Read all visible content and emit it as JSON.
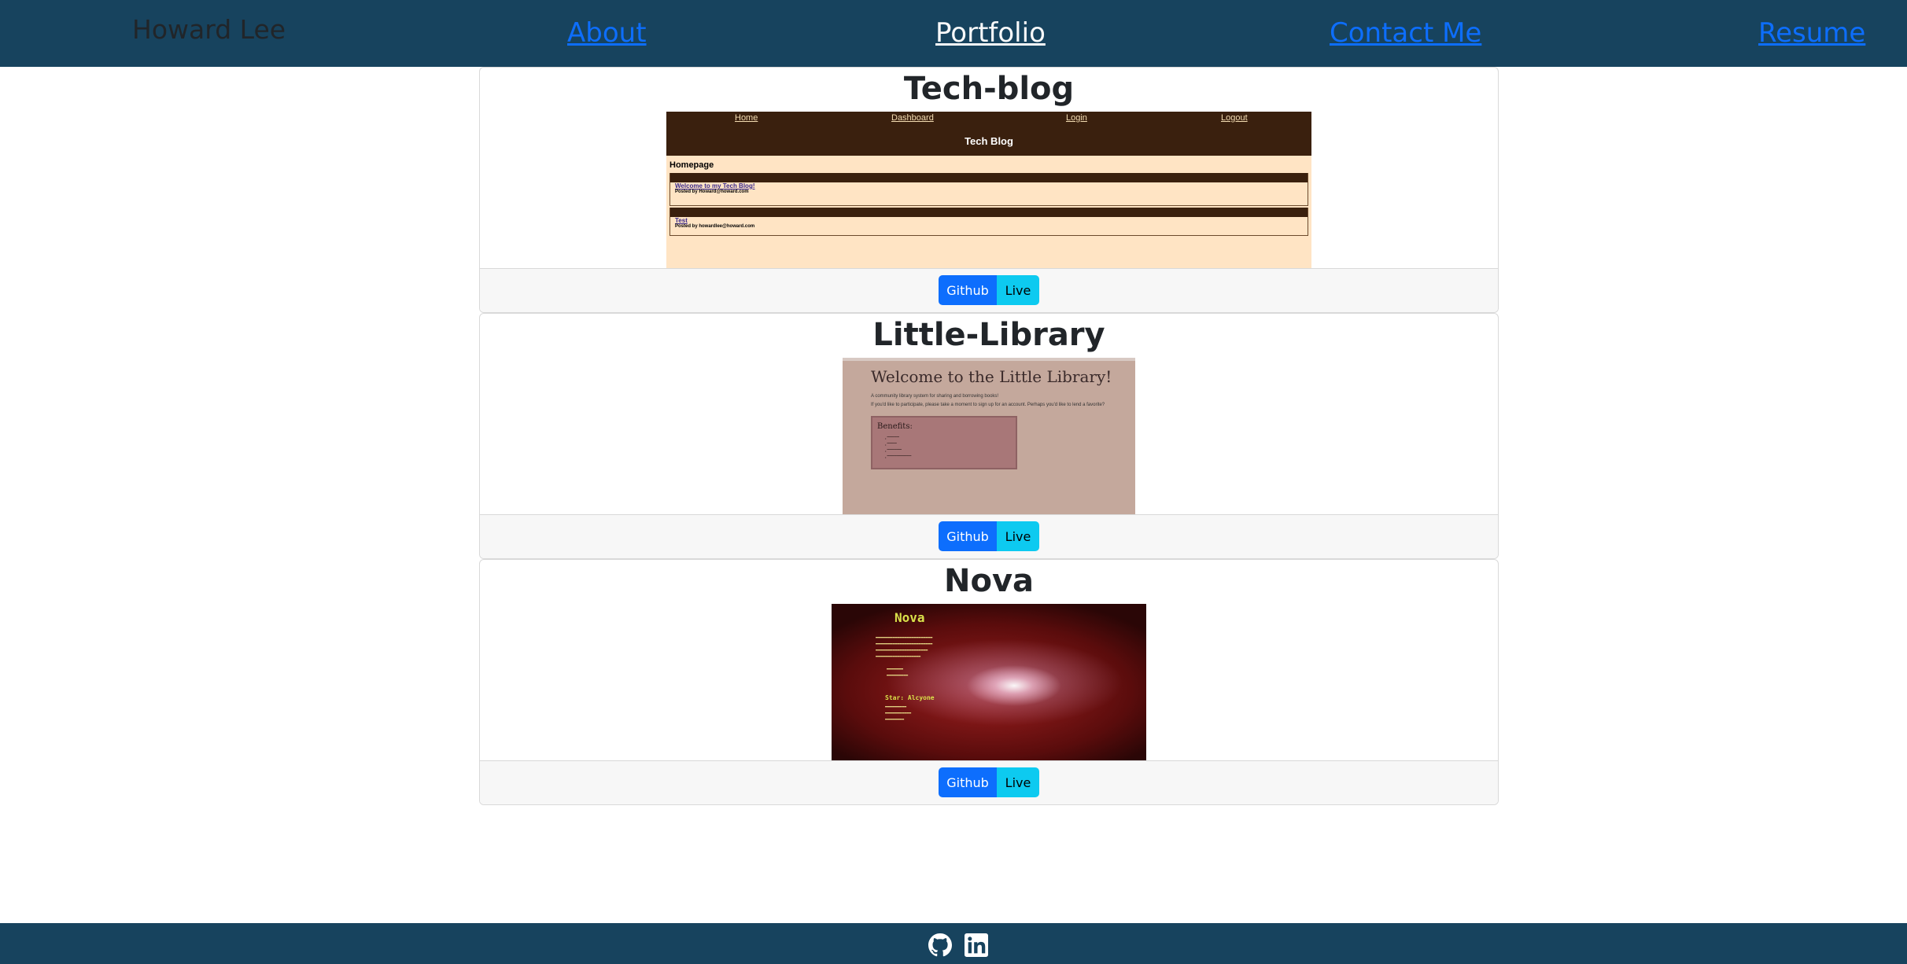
{
  "header": {
    "brand": "Howard Lee",
    "nav": [
      "About",
      "Portfolio",
      "Contact Me",
      "Resume"
    ]
  },
  "projects": [
    {
      "title": "Tech-blog",
      "github_label": "Github",
      "live_label": "Live",
      "preview": {
        "nav": [
          "Home",
          "Dashboard",
          "Login",
          "Logout"
        ],
        "site_title": "Tech Blog",
        "heading": "Homepage",
        "posts": [
          {
            "title": "Welcome to my Tech Blog!",
            "author": "Posted by Howard@howard.com"
          },
          {
            "title": "Test",
            "author": "Posted by howardlee@howard.com"
          }
        ]
      }
    },
    {
      "title": "Little-Library",
      "github_label": "Github",
      "live_label": "Live",
      "preview": {
        "heading": "Welcome to the Little Library!",
        "line1": "A community library system for sharing and borrowing books!",
        "line2": "If you'd like to participate, please take a moment to sign up for an account. Perhaps you'd like to lend a favorite?",
        "box_title": "Benefits:"
      }
    },
    {
      "title": "Nova",
      "github_label": "Github",
      "live_label": "Live",
      "preview": {
        "title": "Nova",
        "star": "Star: Alcyone"
      }
    }
  ],
  "footer": {
    "icons": [
      "github-icon",
      "linkedin-icon"
    ]
  },
  "colors": {
    "navbar": "#17435e",
    "primary": "#0d6efd",
    "info": "#0dcaf0"
  }
}
